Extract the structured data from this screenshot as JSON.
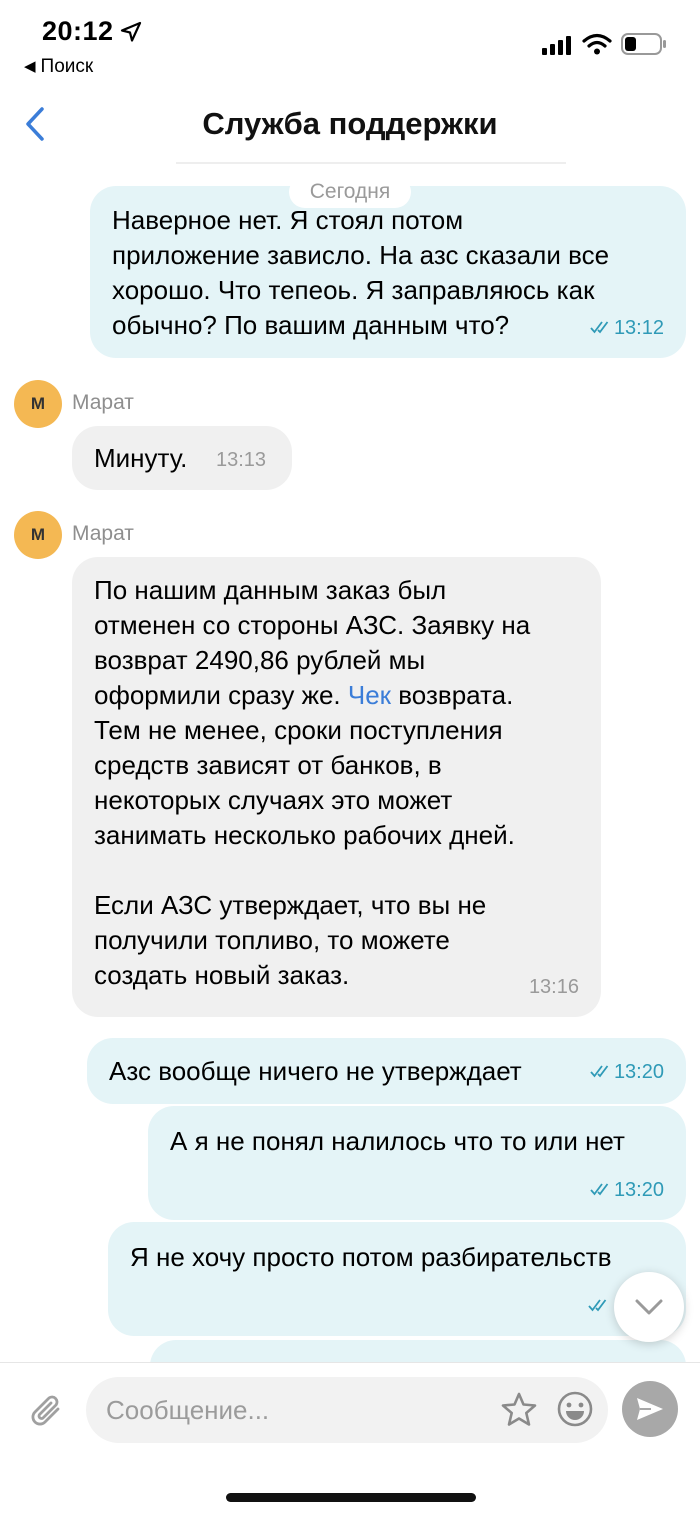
{
  "status_bar": {
    "time": "20:12",
    "back_app": "Поиск",
    "icons": [
      "location-arrow-icon",
      "signal-icon",
      "wifi-icon",
      "battery-icon"
    ]
  },
  "nav": {
    "title": "Служба поддержки",
    "back_icon": "chevron-left-icon"
  },
  "date_divider": "Сегодня",
  "messages": [
    {
      "direction": "outgoing",
      "text": "Наверное нет. Я стоял потом\nприложение зависло. На азс сказали все\nхорошо. Что тепеоь. Я заправляюсь как\nобычно? По вашим данным что?",
      "time": "13:12",
      "status": "read"
    },
    {
      "direction": "incoming",
      "sender": "Марат",
      "avatar_initial": "М",
      "text": "Минуту.",
      "time": "13:13"
    },
    {
      "direction": "incoming",
      "sender": "Марат",
      "avatar_initial": "М",
      "text_before_link": "По нашим данным заказ был\nотменен со стороны АЗС. Заявку на\nвозврат 2490,86 рублей мы\nоформили сразу же. ",
      "link_text": "Чек",
      "text_after_link": " возврата.\nТем не менее, сроки поступления\nсредств зависят от банков, в\nнекоторых случаях это может\nзанимать несколько рабочих дней.\n\nЕсли АЗС утверждает, что вы не\nполучили топливо, то можете\nсоздать новый заказ.",
      "time": "13:16"
    },
    {
      "direction": "outgoing",
      "text": "Азс вообще ничего не утверждает",
      "time": "13:20",
      "status": "read"
    },
    {
      "direction": "outgoing",
      "text": "А я не понял налилось что то или нет",
      "time": "13:20",
      "status": "read"
    },
    {
      "direction": "outgoing",
      "text": "Я не хочу просто потом разбирательств",
      "time": "",
      "status": "read"
    }
  ],
  "composer": {
    "placeholder": "Сообщение...",
    "icons": [
      "paperclip-icon",
      "star-icon",
      "smile-icon",
      "send-icon"
    ]
  },
  "colors": {
    "outgoing_bubble": "#e4f4f7",
    "incoming_bubble": "#f0f0f0",
    "accent": "#2f9ab7",
    "link": "#3b7dd8",
    "avatar": "#f4b853"
  }
}
